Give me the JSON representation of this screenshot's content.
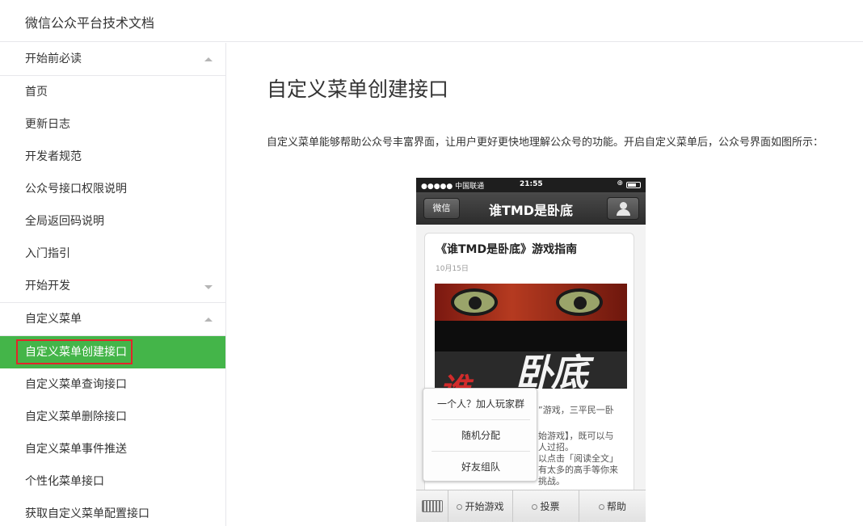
{
  "header": {
    "title": "微信公众平台技术文档"
  },
  "sidebar": {
    "group_before": {
      "label": "开始前必读",
      "expanded": true
    },
    "items_before": [
      {
        "label": "首页"
      },
      {
        "label": "更新日志"
      },
      {
        "label": "开发者规范"
      },
      {
        "label": "公众号接口权限说明"
      },
      {
        "label": "全局返回码说明"
      },
      {
        "label": "入门指引"
      }
    ],
    "group_dev": {
      "label": "开始开发",
      "expanded": false
    },
    "group_menu": {
      "label": "自定义菜单",
      "expanded": true
    },
    "items_menu": [
      {
        "label": "自定义菜单创建接口",
        "active": true
      },
      {
        "label": "自定义菜单查询接口"
      },
      {
        "label": "自定义菜单删除接口"
      },
      {
        "label": "自定义菜单事件推送"
      },
      {
        "label": "个性化菜单接口"
      },
      {
        "label": "获取自定义菜单配置接口"
      }
    ]
  },
  "main": {
    "title": "自定义菜单创建接口",
    "intro": "自定义菜单能够帮助公众号丰富界面，让用户更好更快地理解公众号的功能。开启自定义菜单后，公众号界面如图所示：",
    "phone": {
      "carrier": "●●●●● 中国联通",
      "time": "21:55",
      "back_label": "微信",
      "account_name": "谁TMD是卧底",
      "article_title": "《谁TMD是卧底》游戏指南",
      "article_date": "10月15日",
      "cover_text": "卧底",
      "cover_text_red": "谁",
      "snippets": [
        "”游戏，三平民一卧",
        "始游戏】，既可以与",
        "人过招。",
        "以点击「阅读全文」",
        "有太多的高手等你来",
        "挑战。"
      ],
      "submenu": [
        "一个人？加人玩家群",
        "随机分配",
        "好友组队"
      ],
      "menu": [
        "开始游戏",
        "投票",
        "帮助"
      ]
    }
  },
  "colors": {
    "active": "#44b549",
    "highlight_box": "#e2262a",
    "divider": "#e7e7eb"
  }
}
